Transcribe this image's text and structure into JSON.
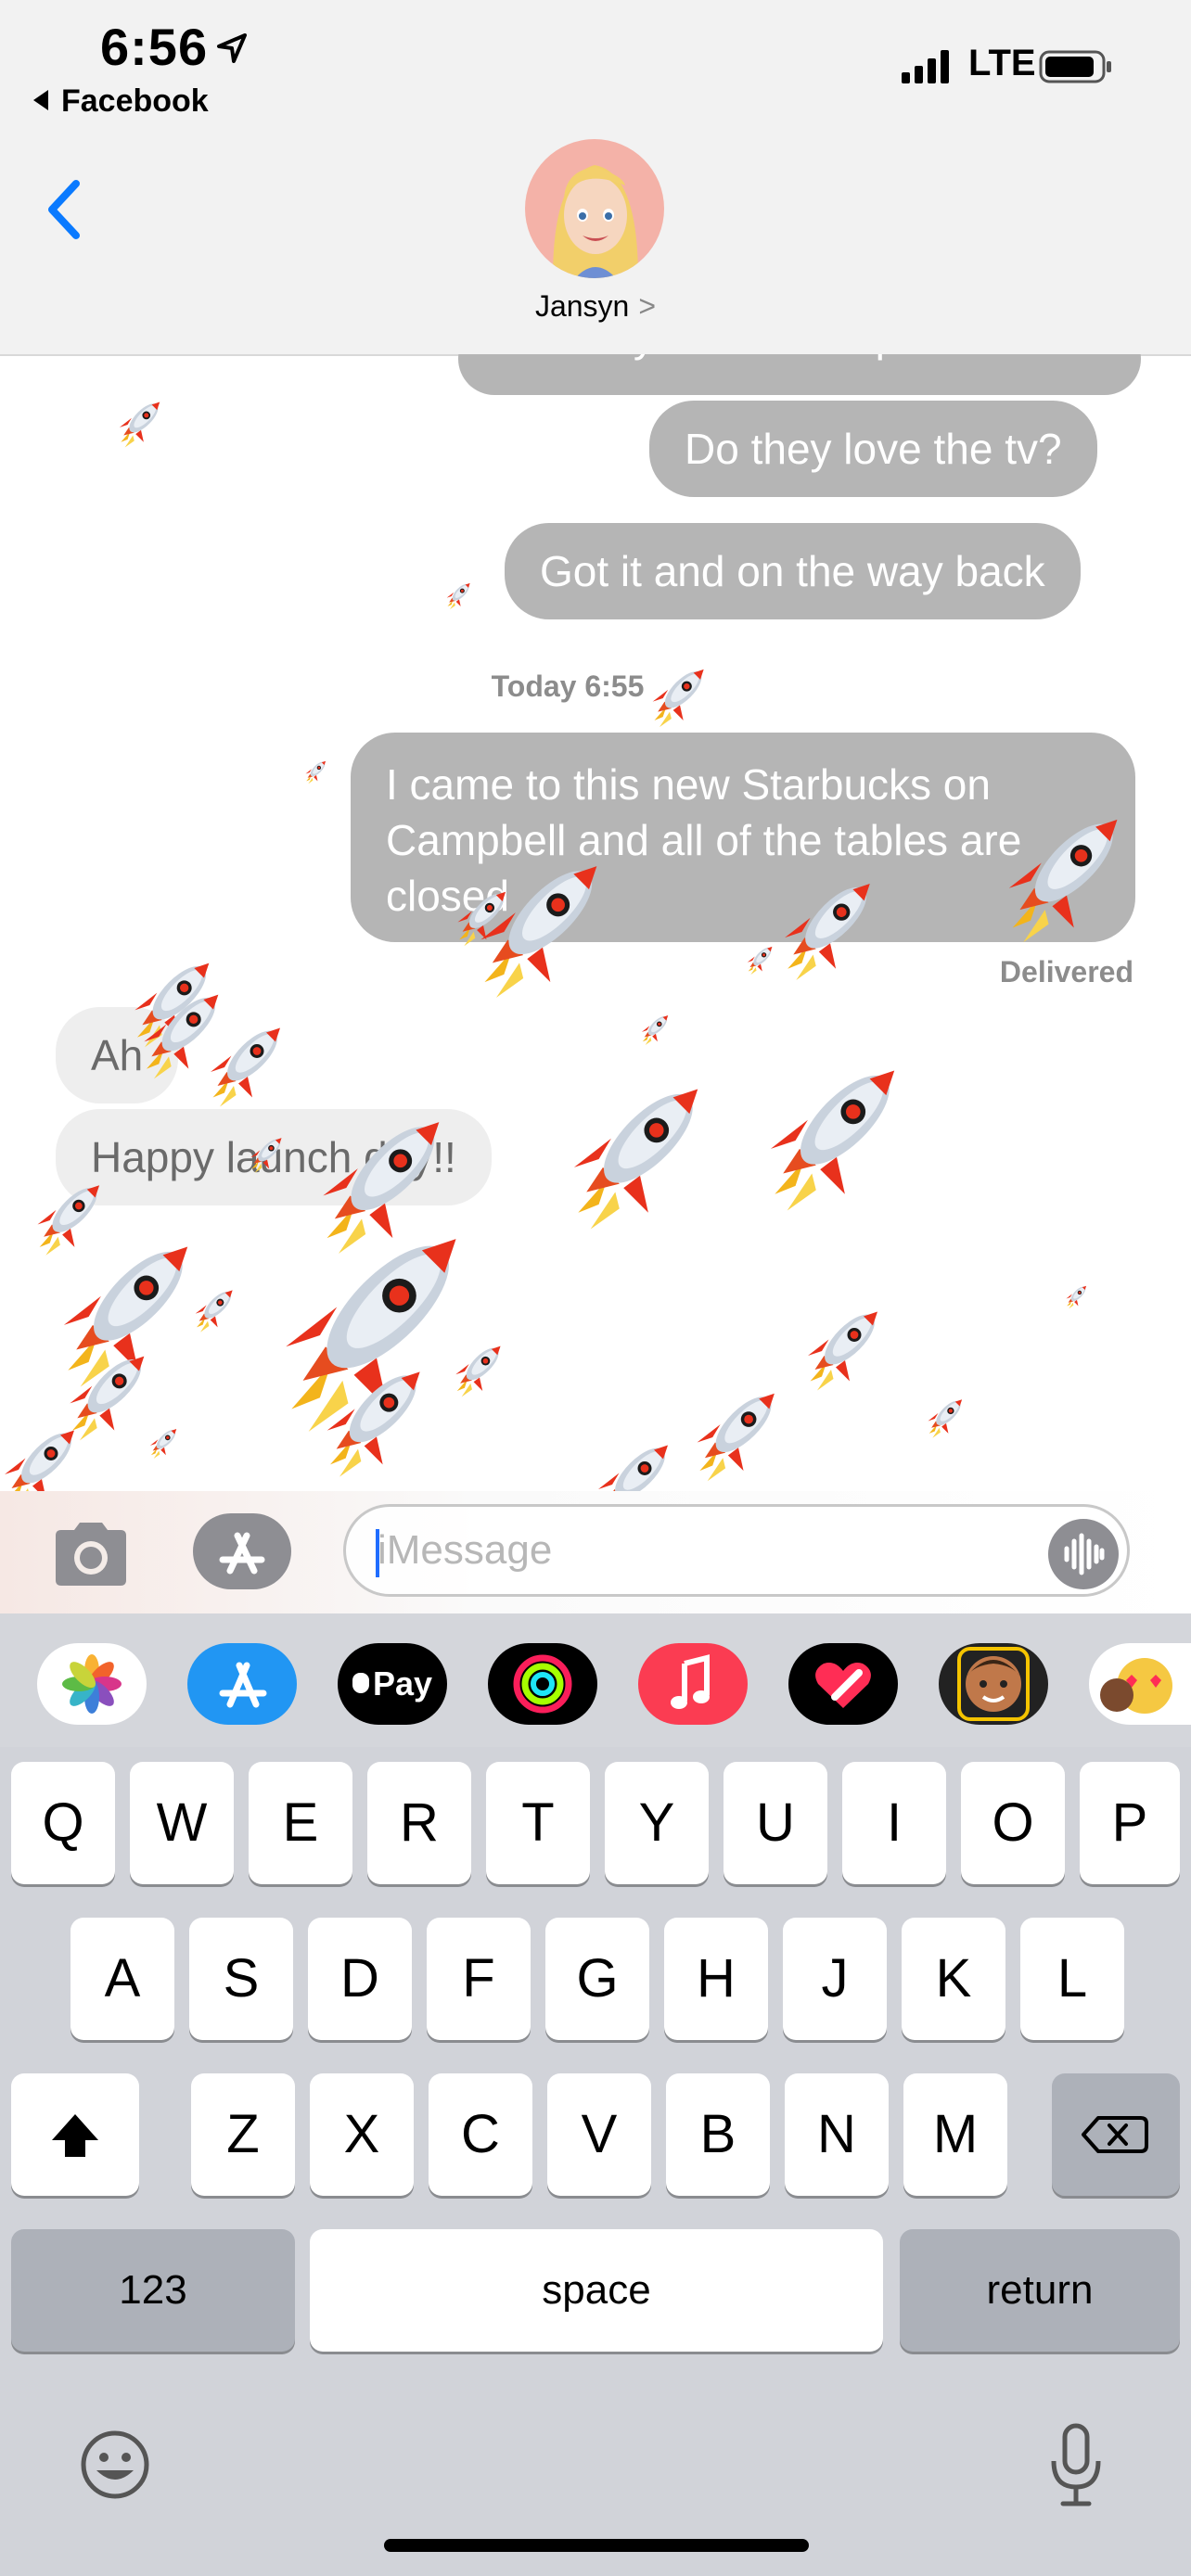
{
  "status_bar": {
    "time": "6:56",
    "back_app": "Facebook",
    "network": "LTE"
  },
  "header": {
    "contact_name": "Jansyn",
    "chevron": ">"
  },
  "messages": {
    "partial_top": "Heart eyes to those pictures!",
    "m1": "Do they love the tv?",
    "m2": "Got it and on the way back",
    "timestamp": "Today 6:55",
    "m3_line1": "I came to this new Starbucks on",
    "m3_line2": "Campbell and all of the tables are",
    "m3_line3": "closed",
    "delivered": "Delivered",
    "r1": "Ah",
    "r2": "Happy launch day!!"
  },
  "compose": {
    "placeholder": "iMessage"
  },
  "app_drawer": {
    "apps": [
      "photos-app",
      "app-store",
      "apple-pay",
      "activity",
      "music",
      "digital-touch",
      "memoji",
      "memoji-stickers"
    ],
    "apple_pay_label": "Pay"
  },
  "keyboard": {
    "row1": [
      "Q",
      "W",
      "E",
      "R",
      "T",
      "Y",
      "U",
      "I",
      "O",
      "P"
    ],
    "row2": [
      "A",
      "S",
      "D",
      "F",
      "G",
      "H",
      "J",
      "K",
      "L"
    ],
    "row3": [
      "Z",
      "X",
      "C",
      "V",
      "B",
      "N",
      "M"
    ],
    "numbers_key": "123",
    "space_key": "space",
    "return_key": "return"
  },
  "colors": {
    "accent": "#0a7aff",
    "outgoing_bubble": "#b5b5b5",
    "incoming_bubble": "#eeeeee"
  }
}
